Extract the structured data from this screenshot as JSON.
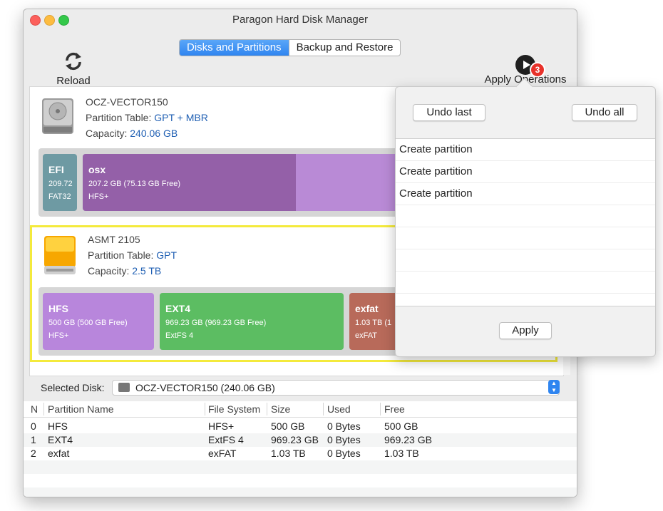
{
  "window": {
    "title": "Paragon Hard Disk Manager"
  },
  "tabs": [
    {
      "label": "Disks and Partitions",
      "active": true
    },
    {
      "label": "Backup and Restore",
      "active": false
    }
  ],
  "toolbar": {
    "reload_label": "Reload",
    "apply_ops_label": "Apply Operations",
    "pending_count": "3"
  },
  "disks": [
    {
      "name": "OCZ-VECTOR150",
      "partition_table_label": "Partition Table:",
      "partition_table": "GPT + MBR",
      "capacity_label": "Capacity:",
      "capacity": "240.06 GB",
      "partitions": [
        {
          "name": "EFI",
          "size": "209.72",
          "fs": "FAT32",
          "color": "#6e9aa3"
        },
        {
          "name": "osx",
          "size": "207.2 GB (75.13 GB Free)",
          "fs": "HFS+",
          "color": "#9460a8",
          "free_color": "#b98ad6"
        }
      ]
    },
    {
      "name": "ASMT 2105",
      "partition_table_label": "Partition Table:",
      "partition_table": "GPT",
      "capacity_label": "Capacity:",
      "capacity": "2.5 TB",
      "partitions": [
        {
          "name": "HFS",
          "size": "500 GB (500 GB Free)",
          "fs": "HFS+",
          "color": "#b886dc"
        },
        {
          "name": "EXT4",
          "size": "969.23 GB (969.23 GB Free)",
          "fs": "ExtFS 4",
          "color": "#5cbd62"
        },
        {
          "name": "exfat",
          "size": "1.03 TB (1",
          "fs": "exFAT",
          "color": "#b86a5a"
        }
      ]
    }
  ],
  "selected_disk": {
    "label": "Selected Disk:",
    "value": "OCZ-VECTOR150 (240.06 GB)"
  },
  "table": {
    "columns": [
      "N",
      "Partition Name",
      "File System",
      "Size",
      "Used",
      "Free"
    ],
    "rows": [
      [
        "0",
        "HFS",
        "HFS+",
        "500 GB",
        "0 Bytes",
        "500 GB"
      ],
      [
        "1",
        "EXT4",
        "ExtFS 4",
        "969.23 GB",
        "0 Bytes",
        "969.23 GB"
      ],
      [
        "2",
        "exfat",
        "exFAT",
        "1.03 TB",
        "0 Bytes",
        "1.03 TB"
      ]
    ]
  },
  "popover": {
    "undo_last": "Undo last",
    "undo_all": "Undo all",
    "operations": [
      "Create partition",
      "Create partition",
      "Create partition"
    ],
    "apply": "Apply"
  }
}
